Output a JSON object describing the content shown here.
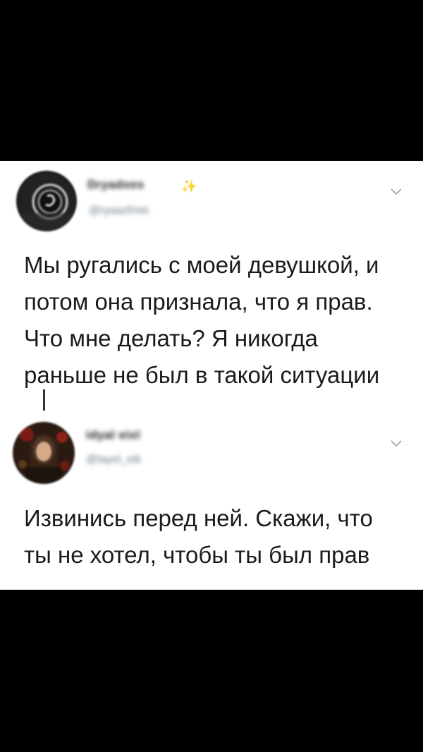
{
  "tweets": [
    {
      "display_name": "Dryadxes",
      "handle": "@ryaazfmie",
      "text": "Мы ругались с моей девушкой, и\nпотом она признала, что я прав.\nЧто мне делать? Я никогда\nраньше не был в такой ситуации"
    },
    {
      "display_name": "idyal eixl",
      "handle": "@layel_eik",
      "text": "Извинись перед ней. Скажи, что\nты не хотел, чтобы ты был прав"
    }
  ],
  "icons": {
    "sparkle": "✨",
    "chevron": "chevron-down-icon"
  },
  "colors": {
    "background": "#000000",
    "card": "#ffffff",
    "text": "#1b1b1b",
    "handle": "#657786"
  }
}
